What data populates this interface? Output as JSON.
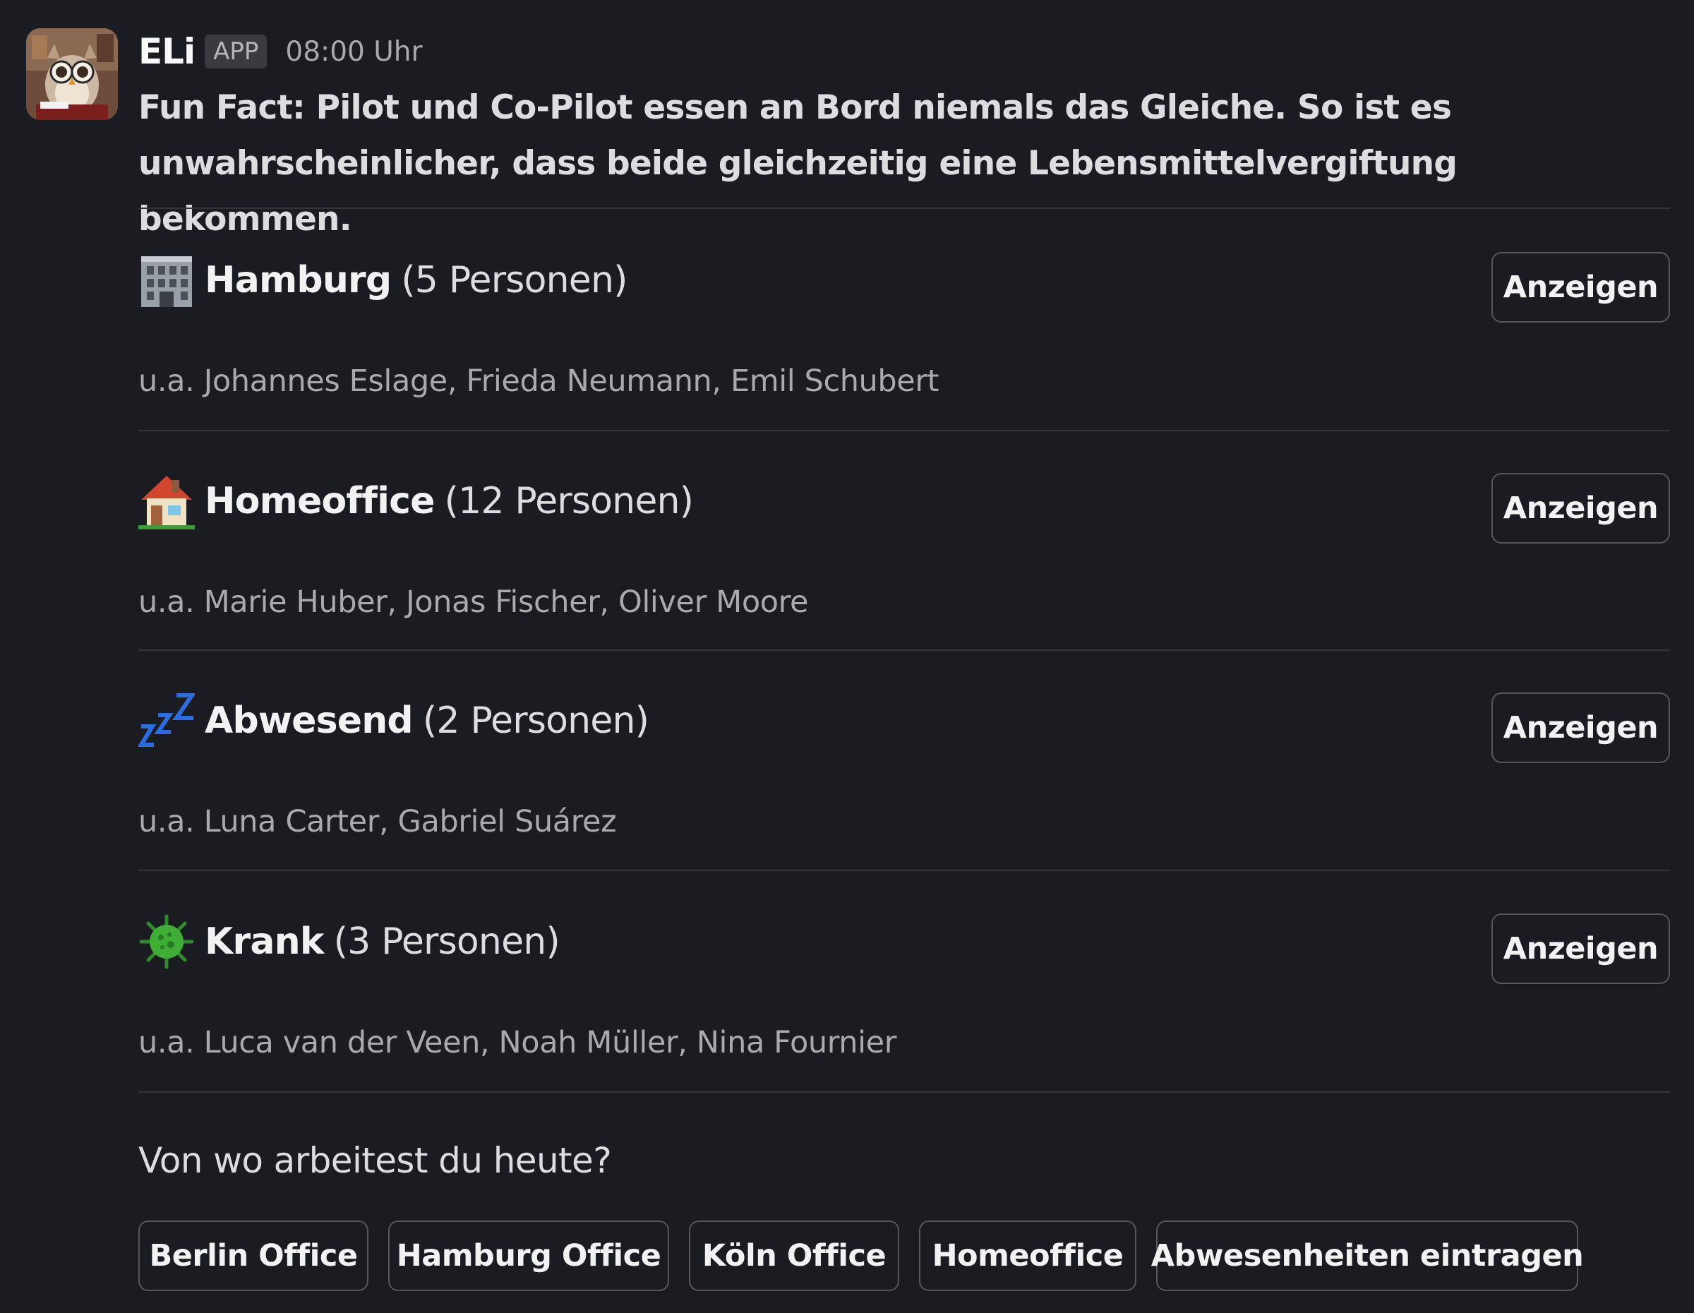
{
  "message": {
    "sender": "ELi",
    "badge": "APP",
    "time": "08:00 Uhr",
    "intro_line1": "Fun Fact: Pilot und Co-Pilot essen an Bord niemals das Gleiche. So ist es",
    "intro_line2": "unwahrscheinlicher, dass beide gleichzeitig eine Lebensmittelvergiftung bekommen."
  },
  "sections": [
    {
      "icon": "office-building-icon",
      "name": "Hamburg",
      "count": "(5 Personen)",
      "people": "u.a. Johannes Eslage, Frieda Neumann, Emil Schubert",
      "button": "Anzeigen"
    },
    {
      "icon": "house-icon",
      "name": "Homeoffice",
      "count": "(12 Personen)",
      "people": "u.a. Marie Huber, Jonas Fischer, Oliver Moore",
      "button": "Anzeigen"
    },
    {
      "icon": "zzz-icon",
      "name": "Abwesend",
      "count": "(2 Personen)",
      "people": "u.a. Luna Carter, Gabriel Suárez",
      "button": "Anzeigen"
    },
    {
      "icon": "microbe-icon",
      "name": "Krank",
      "count": "(3 Personen)",
      "people": "u.a. Luca van der Veen, Noah Müller, Nina Fournier",
      "button": "Anzeigen"
    }
  ],
  "question": "Von wo arbeitest du heute?",
  "actions": [
    "Berlin Office",
    "Hamburg Office",
    "Köln Office",
    "Homeoffice",
    "Abwesenheiten eintragen"
  ],
  "colors": {
    "background": "#1b1c22",
    "divider": "#34353b",
    "button_border": "#55575c",
    "zzz_blue": "#2b6de0",
    "microbe_green": "#3fae35"
  }
}
